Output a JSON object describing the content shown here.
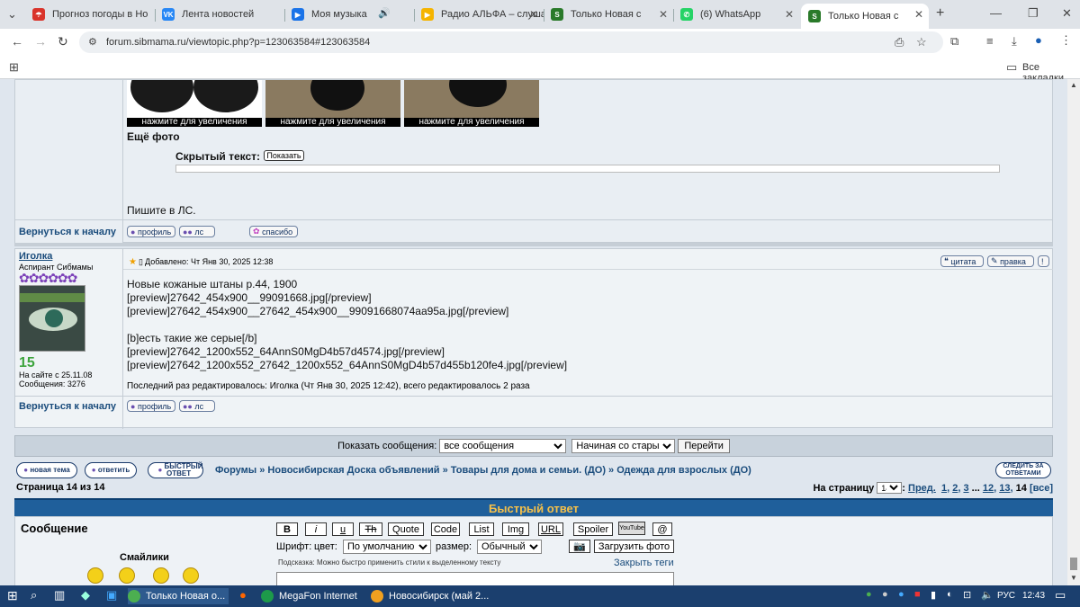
{
  "browser": {
    "tabs": [
      {
        "title": "Прогноз погоды в Но",
        "icon": "umbrella-icon",
        "color": "#d9342b"
      },
      {
        "title": "Лента новостей",
        "icon": "vk-icon",
        "color": "#2787f5"
      },
      {
        "title": "Моя музыка",
        "icon": "play-icon",
        "color": "#1a73e8"
      },
      {
        "title": "Радио АЛЬФА – слуша",
        "icon": "radio-icon",
        "color": "#e02020"
      },
      {
        "title": "Только Новая с",
        "icon": "forum-icon",
        "color": "#2a7a2a"
      },
      {
        "title": "(6) WhatsApp",
        "icon": "whatsapp-icon",
        "color": "#25d366"
      },
      {
        "title": "Только Новая с",
        "icon": "forum-icon",
        "color": "#2a7a2a"
      }
    ],
    "url": "forum.sibmama.ru/viewtopic.php?p=123063584#123063584",
    "bookmarks_label": "Все закладки"
  },
  "post1": {
    "photo_caption": "нажмите для увеличения",
    "more_photos": "Ещё фото",
    "hidden_label": "Скрытый текст:",
    "show_button": "Показать",
    "write_pm": "Пишите в ЛС.",
    "back_to_top": "Вернуться к началу",
    "profile_btn": "профиль",
    "pm_btn": "лс",
    "thanks_btn": "спасибо"
  },
  "post2": {
    "author": "Иголка",
    "rank": "Аспирант Сибмамы",
    "level": "15",
    "joined": "На сайте с 25.11.08",
    "messages": "Сообщения: 3276",
    "added": "Добавлено: Чт Янв 30, 2025 12:38",
    "quote_btn": "цитата",
    "edit_btn": "правка",
    "lines": [
      "Новые кожаные штаны р.44, 1900",
      "[preview]27642_454x900__99091668.jpg[/preview]",
      "[preview]27642_454x900__27642_454x900__99091668074aa95a.jpg[/preview]",
      "",
      "[b]есть такие же серые[/b]",
      "[preview]27642_1200x552_64AnnS0MgD4b57d4574.jpg[/preview]",
      "[preview]27642_1200x552_27642_1200x552_64AnnS0MgD4b57d455b120fe4.jpg[/preview]"
    ],
    "edited_note": "Последний раз редактировалось: Иголка (Чт Янв 30, 2025 12:42), всего редактировалось 2 раза",
    "back_to_top": "Вернуться к началу",
    "profile_btn": "профиль",
    "pm_btn": "лс"
  },
  "sort": {
    "label": "Показать сообщения:",
    "filter": "все сообщения",
    "order": "Начиная со старых",
    "go": "Перейти"
  },
  "nav": {
    "new_topic": "новая тема",
    "reply": "ответить",
    "quick_reply": "БЫСТРЫЙ ОТВЕТ",
    "breadcrumb": [
      "Форумы",
      "Новосибирская Доска объявлений",
      "Товары для дома и семьи. (ДО)",
      "Одежда для взрослых (ДО)"
    ],
    "watch": "СЛЕДИТЬ ЗА ОТВЕТАМИ",
    "page_info": "Страница 14 из 14",
    "to_page": "На страницу",
    "page_select": "14",
    "prev": "Пред.",
    "pages": [
      "1",
      "2",
      "3",
      "...",
      "12",
      "13"
    ],
    "current": "14",
    "all": "[все]"
  },
  "quick_reply": {
    "header": "Быстрый ответ",
    "message_label": "Сообщение",
    "smilies_label": "Смайлики",
    "format_buttons": [
      "B",
      "i",
      "u",
      "Th",
      "Quote",
      "Code",
      "List",
      "Img",
      "URL",
      "Spoiler",
      "YouTube",
      "@"
    ],
    "font_label": "Шрифт:",
    "color_label": "цвет:",
    "color_value": "По умолчанию",
    "size_label": "размер:",
    "size_value": "Обычный",
    "upload_btn": "Загрузить фото",
    "hint": "Подсказка: Можно быстро применить стили к выделенному тексту",
    "close_tags": "Закрыть теги"
  },
  "taskbar": {
    "items": [
      "Только Новая о...",
      "MegaFon Internet",
      "Новосибирск (май 2..."
    ],
    "lang": "РУС",
    "time": "12:43"
  }
}
